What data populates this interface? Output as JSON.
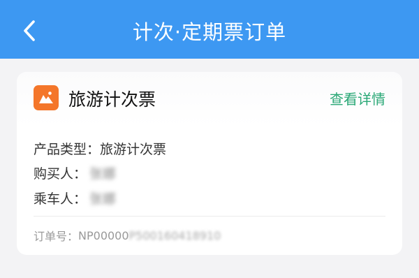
{
  "header": {
    "title": "计次·定期票订单",
    "back_icon": "chevron-left-icon"
  },
  "card": {
    "icon": "ticket-app-icon",
    "title": "旅游计次票",
    "detail_link": "查看详情",
    "product_type_label": "产品类型：",
    "product_type_value": "旅游计次票",
    "buyer_label": "购买人：",
    "buyer_value": "张娜",
    "passenger_label": "乘车人：",
    "passenger_value": "张娜",
    "order_label": "订单号：",
    "order_prefix": "NP00000",
    "order_rest": "P500160418910"
  },
  "colors": {
    "header_bg": "#3d98f2",
    "accent_green": "#2aa876",
    "icon_orange": "#f4762a",
    "page_bg": "#f3f3f5"
  }
}
